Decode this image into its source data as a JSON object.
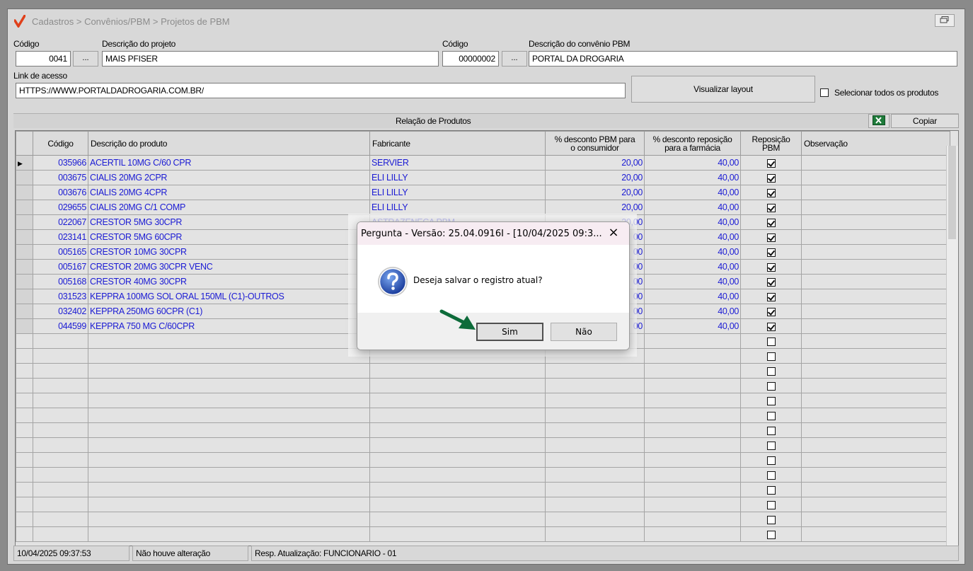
{
  "window": {
    "breadcrumb": "Cadastros > Convênios/PBM > Projetos de PBM",
    "restore_icon": "restore-icon"
  },
  "project": {
    "code_label": "Código",
    "code_value": "0041",
    "desc_label": "Descrição do projeto",
    "desc_value": "MAIS PFISER",
    "ellipsis": "..."
  },
  "agreement": {
    "code_label": "Código",
    "code_value": "00000002",
    "desc_label": "Descrição do convênio PBM",
    "desc_value": "PORTAL DA DROGARIA",
    "ellipsis": "..."
  },
  "link": {
    "label": "Link de acesso",
    "value": "HTTPS://WWW.PORTALDADROGARIA.COM.BR/",
    "layout_button": "Visualizar layout",
    "select_all_label": "Selecionar todos os produtos"
  },
  "grid": {
    "section_title": "Relação de Produtos",
    "copy_button": "Copiar",
    "excel_icon": "excel-icon",
    "headers": {
      "code": "Código",
      "desc": "Descrição do produto",
      "maker": "Fabricante",
      "disc_consumer_1": "% desconto PBM para",
      "disc_consumer_2": "o consumidor",
      "disc_repl_1": "% desconto reposição",
      "disc_repl_2": "para a farmácia",
      "repl_pbm_1": "Reposição",
      "repl_pbm_2": "PBM",
      "obs": "Observação"
    },
    "rows": [
      {
        "code": "035966",
        "desc": "ACERTIL 10MG C/60 CPR",
        "maker": "SERVIER",
        "disc_consumer": "20,00",
        "disc_repl": "40,00",
        "repl_pbm": true
      },
      {
        "code": "003675",
        "desc": "CIALIS 20MG 2CPR",
        "maker": "ELI LILLY",
        "disc_consumer": "20,00",
        "disc_repl": "40,00",
        "repl_pbm": true
      },
      {
        "code": "003676",
        "desc": "CIALIS 20MG 4CPR",
        "maker": "ELI LILLY",
        "disc_consumer": "20,00",
        "disc_repl": "40,00",
        "repl_pbm": true
      },
      {
        "code": "029655",
        "desc": "CIALIS 20MG C/1 COMP",
        "maker": "ELI LILLY",
        "disc_consumer": "20,00",
        "disc_repl": "40,00",
        "repl_pbm": true
      },
      {
        "code": "022067",
        "desc": "CRESTOR  5MG 30CPR",
        "maker": "ASTRAZENECA PBM",
        "disc_consumer": "20,00",
        "disc_repl": "40,00",
        "repl_pbm": true
      },
      {
        "code": "023141",
        "desc": "CRESTOR  5MG 60CPR",
        "maker": "",
        "disc_consumer": "00",
        "disc_repl": "40,00",
        "repl_pbm": true
      },
      {
        "code": "005165",
        "desc": "CRESTOR 10MG 30CPR",
        "maker": "",
        "disc_consumer": "00",
        "disc_repl": "40,00",
        "repl_pbm": true
      },
      {
        "code": "005167",
        "desc": "CRESTOR 20MG 30CPR VENC",
        "maker": "",
        "disc_consumer": "00",
        "disc_repl": "40,00",
        "repl_pbm": true
      },
      {
        "code": "005168",
        "desc": "CRESTOR 40MG 30CPR",
        "maker": "",
        "disc_consumer": "00",
        "disc_repl": "40,00",
        "repl_pbm": true
      },
      {
        "code": "031523",
        "desc": "KEPPRA 100MG SOL ORAL 150ML (C1)-OUTROS",
        "maker": "",
        "disc_consumer": "00",
        "disc_repl": "40,00",
        "repl_pbm": true
      },
      {
        "code": "032402",
        "desc": "KEPPRA 250MG 60CPR (C1)",
        "maker": "",
        "disc_consumer": "00",
        "disc_repl": "40,00",
        "repl_pbm": true
      },
      {
        "code": "044599",
        "desc": "KEPPRA 750 MG C/60CPR",
        "maker": "",
        "disc_consumer": "00",
        "disc_repl": "40,00",
        "repl_pbm": true
      }
    ],
    "empty_rows": 14
  },
  "status": {
    "datetime": "10/04/2025 09:37:53",
    "change": "Não houve alteração",
    "updated_by": "Resp. Atualização: FUNCIONARIO - 01"
  },
  "dialog": {
    "title": "Pergunta - Versão: 25.04.0916I - [10/04/2025 09:3...",
    "message": "Deseja salvar o registro atual?",
    "yes": "Sim",
    "no": "Não",
    "icon": "question-icon",
    "close_icon": "close-icon",
    "pointer_icon": "arrow-pointer-icon"
  }
}
